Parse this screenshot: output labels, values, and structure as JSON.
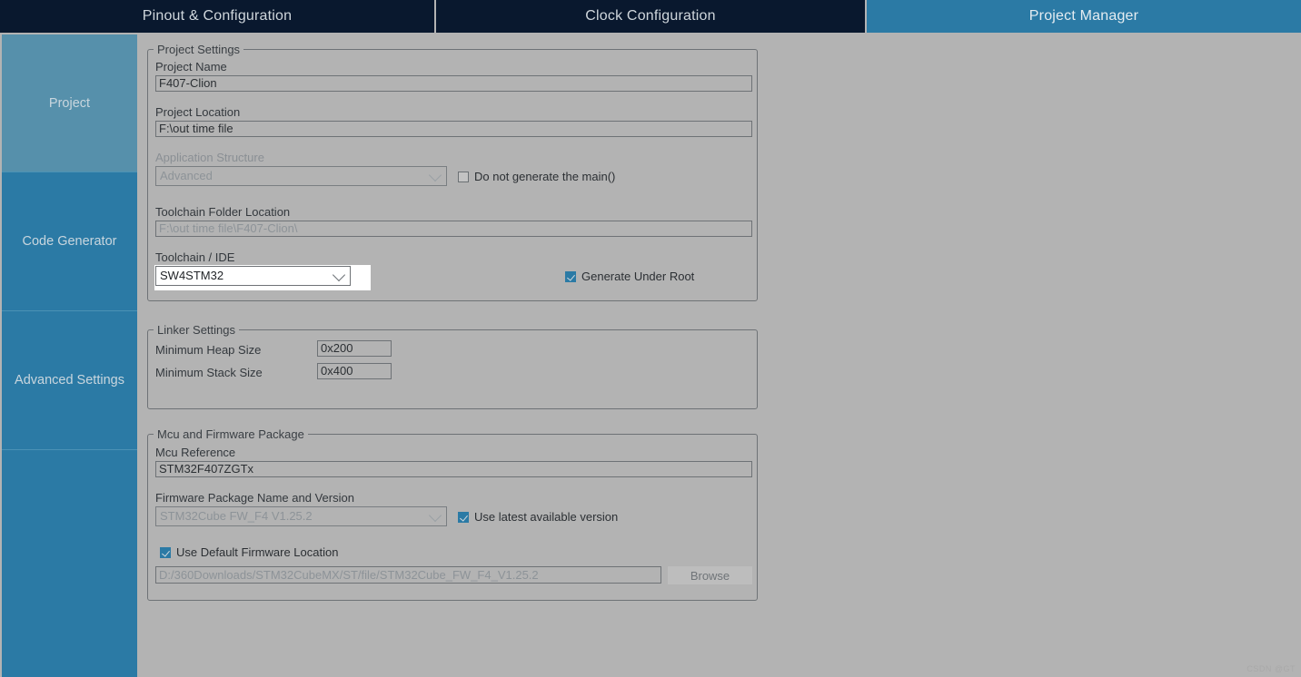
{
  "tabs": [
    {
      "label": "Pinout & Configuration",
      "active": false
    },
    {
      "label": "Clock Configuration",
      "active": false
    },
    {
      "label": "Project Manager",
      "active": true
    }
  ],
  "sidebar": {
    "items": [
      {
        "label": "Project",
        "selected": true
      },
      {
        "label": "Code Generator",
        "selected": false
      },
      {
        "label": "Advanced Settings",
        "selected": false
      },
      {
        "label": "",
        "selected": false
      }
    ]
  },
  "project_settings": {
    "legend": "Project Settings",
    "project_name_label": "Project Name",
    "project_name_value": "F407-Clion",
    "project_location_label": "Project Location",
    "project_location_value": "F:\\out time file",
    "application_structure_label": "Application Structure",
    "application_structure_value": "Advanced",
    "do_not_generate_main_label": "Do not generate the main()",
    "do_not_generate_main_checked": false,
    "toolchain_folder_label": "Toolchain Folder Location",
    "toolchain_folder_value": "F:\\out time file\\F407-Clion\\",
    "toolchain_ide_label": "Toolchain / IDE",
    "toolchain_ide_value": "SW4STM32",
    "generate_under_root_label": "Generate Under Root",
    "generate_under_root_checked": true
  },
  "linker_settings": {
    "legend": "Linker Settings",
    "min_heap_label": "Minimum Heap Size",
    "min_heap_value": "0x200",
    "min_stack_label": "Minimum Stack Size",
    "min_stack_value": "0x400"
  },
  "mcu_firmware": {
    "legend": "Mcu and Firmware Package",
    "mcu_reference_label": "Mcu Reference",
    "mcu_reference_value": "STM32F407ZGTx",
    "firmware_package_label": "Firmware Package Name and Version",
    "firmware_package_value": "STM32Cube FW_F4 V1.25.2",
    "use_latest_label": "Use latest available version",
    "use_latest_checked": true,
    "use_default_location_label": "Use Default Firmware Location",
    "use_default_location_checked": true,
    "firmware_path_value": "D:/360Downloads/STM32CubeMX/ST/file/STM32Cube_FW_F4_V1.25.2",
    "browse_label": "Browse"
  },
  "watermark": "CSDN @GT",
  "colors": {
    "accent": "#2b7aa5",
    "tab_inactive": "#09182e",
    "background": "#b3b3b3",
    "sidebar_selected": "#5690ab"
  }
}
